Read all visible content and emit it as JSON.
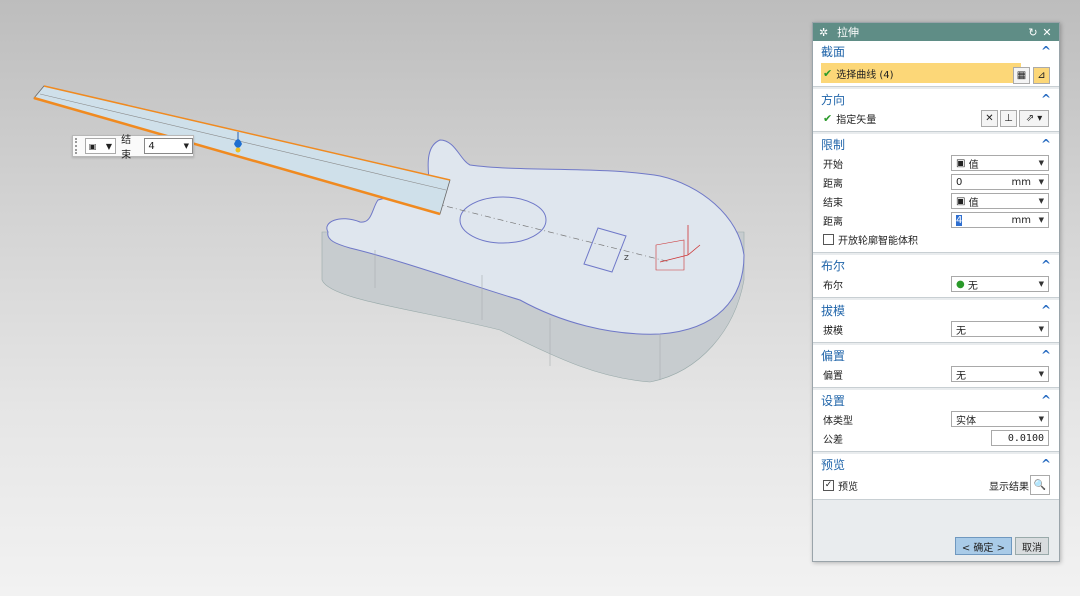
{
  "minibar": {
    "label": "结束",
    "value": "4"
  },
  "dialog": {
    "title": "拉伸",
    "section": {
      "title": "截面",
      "select_curve": "选择曲线 (4)"
    },
    "direction": {
      "title": "方向",
      "vector": "指定矢量"
    },
    "limits": {
      "title": "限制",
      "start_label": "开始",
      "start_type": "值",
      "distance1_label": "距离",
      "distance1_value": "0",
      "distance1_unit": "mm",
      "end_label": "结束",
      "end_type": "值",
      "distance2_label": "距离",
      "distance2_value": "4",
      "distance2_unit": "mm",
      "open_profile": "开放轮廓智能体积"
    },
    "boolean": {
      "title": "布尔",
      "label": "布尔",
      "value": "无"
    },
    "draft": {
      "title": "拔模",
      "label": "拔模",
      "value": "无"
    },
    "offset": {
      "title": "偏置",
      "label": "偏置",
      "value": "无"
    },
    "settings": {
      "title": "设置",
      "body_type_label": "体类型",
      "body_type_value": "实体",
      "tolerance_label": "公差",
      "tolerance_value": "0.0100"
    },
    "preview": {
      "title": "预览",
      "checkbox_label": "预览",
      "show_result": "显示结果"
    },
    "ok": "< 确定 >",
    "cancel": "取消"
  }
}
